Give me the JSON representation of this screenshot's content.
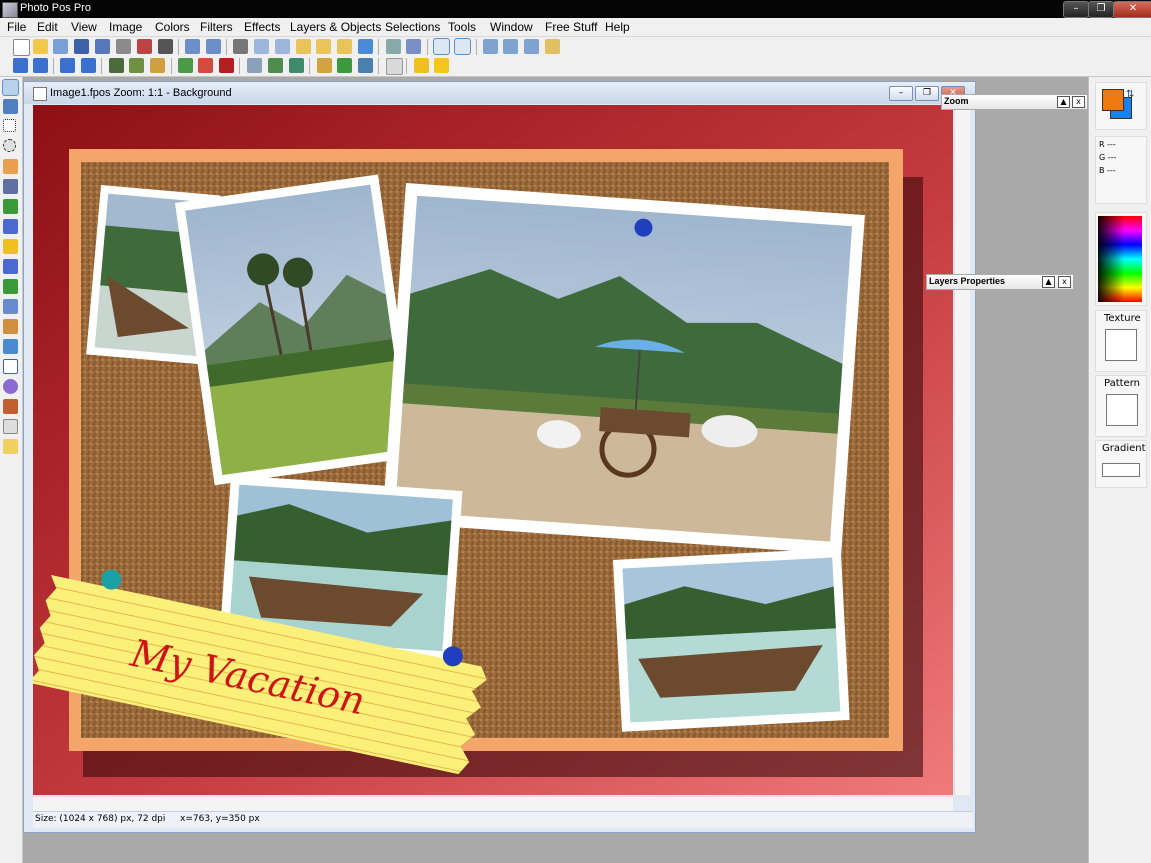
{
  "app": {
    "title": "Photo Pos Pro"
  },
  "menu": [
    "File",
    "Edit",
    "View",
    "Image",
    "Colors",
    "Filters",
    "Effects",
    "Layers & Objects",
    "Selections",
    "Tools",
    "Window",
    "Free Stuff",
    "Help"
  ],
  "document": {
    "title": "Image1.fpos  Zoom: 1:1 - Background"
  },
  "canvas": {
    "note_text": "My Vacation"
  },
  "palettes": {
    "zoom_title": "Zoom",
    "layers_title": "Layers Properties"
  },
  "color_info": {
    "r": "R ---",
    "g": "G ---",
    "b": "B ---"
  },
  "right_panel": {
    "texture": "Texture",
    "pattern": "Pattern",
    "gradient": "Gradient"
  },
  "colors": {
    "foreground": "#f07a10",
    "background": "#1a7ff0"
  },
  "status": {
    "size": "Size: (1024 x 768) px, 72 dpi",
    "coords": "x=763, y=350 px"
  }
}
